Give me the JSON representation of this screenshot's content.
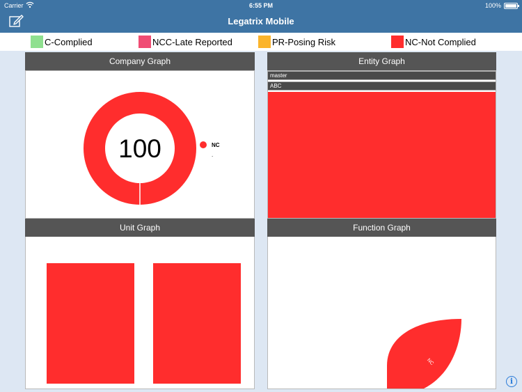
{
  "status_bar": {
    "carrier": "Carrier",
    "time": "6:55 PM",
    "battery": "100%"
  },
  "nav": {
    "title": "Legatrix Mobile"
  },
  "icons": {
    "compose": "compose-icon",
    "wifi": "wifi-icon",
    "battery": "battery-icon",
    "info": "info-icon"
  },
  "legend": [
    {
      "label": "C-Complied",
      "color": "#8fe08f"
    },
    {
      "label": "NCC-Late Reported",
      "color": "#f04c73"
    },
    {
      "label": "PR-Posing Risk",
      "color": "#fbb42b"
    },
    {
      "label": "NC-Not Complied",
      "color": "#ff2d2d"
    }
  ],
  "panels": {
    "company": {
      "title": "Company Graph"
    },
    "entity": {
      "title": "Entity Graph",
      "bars": [
        "master",
        "ABC"
      ]
    },
    "unit": {
      "title": "Unit Graph"
    },
    "function": {
      "title": "Function Graph"
    }
  },
  "chart_data": [
    {
      "type": "pie",
      "chart": "company",
      "center_label": "100",
      "slices": [
        {
          "label": "NC",
          "value": 100,
          "color": "#ff2d2d"
        }
      ],
      "legend_entries": [
        "NC",
        "."
      ],
      "legend_position": "right"
    },
    {
      "type": "bar",
      "chart": "unit",
      "values": [
        100,
        100
      ],
      "ylim": [
        0,
        100
      ],
      "color": "#ff2d2d"
    },
    {
      "type": "pie",
      "chart": "function",
      "slices": [
        {
          "label": "NC",
          "value": 100,
          "color": "#ff2d2d"
        }
      ]
    }
  ]
}
